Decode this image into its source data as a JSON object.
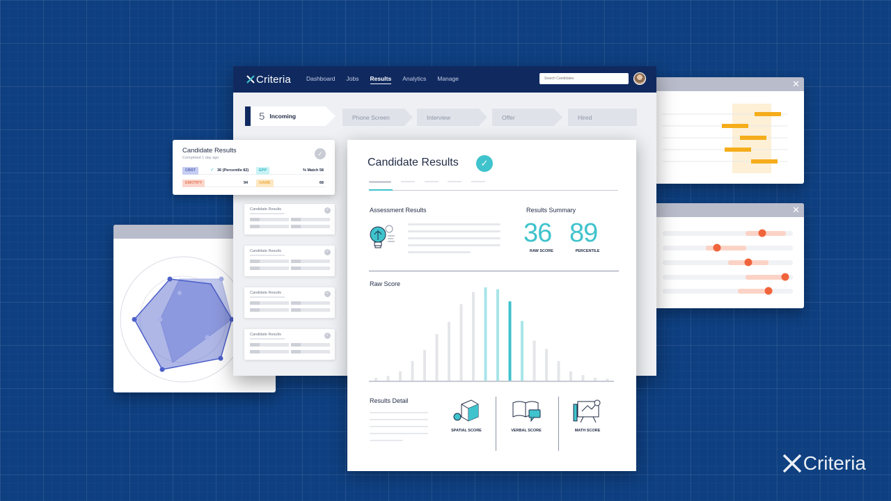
{
  "nav": {
    "brand": "Criteria",
    "links": [
      "Dashboard",
      "Jobs",
      "Results",
      "Analytics",
      "Manage"
    ],
    "active_link": "Results",
    "search_placeholder": "Search Candidates"
  },
  "pipeline": {
    "stages": [
      {
        "count": "5",
        "label": "Incoming"
      },
      {
        "label": "Phone Screen"
      },
      {
        "label": "Interview"
      },
      {
        "label": "Offer"
      },
      {
        "label": "Hired"
      }
    ]
  },
  "candidate_card": {
    "title": "Candidate Results",
    "subtitle": "Completed 1 day ago",
    "tests": [
      {
        "name": "CBST",
        "value": "36 (Percentile 82)",
        "color": "#c5cdf2",
        "text_color": "#5563b3"
      },
      {
        "name": "EPP",
        "value": "% Match 58",
        "color": "#c9f2f5",
        "text_color": "#34b9c4"
      },
      {
        "name": "EMOTIFY",
        "value": "94",
        "color": "#fbd6cc",
        "text_color": "#e8795b"
      },
      {
        "name": "GAME",
        "value": "68",
        "color": "#fde8c4",
        "text_color": "#f0a93c"
      }
    ]
  },
  "mini_cards": [
    {
      "title": "Candidate Results"
    },
    {
      "title": "Candidate Results"
    },
    {
      "title": "Candidate Results"
    },
    {
      "title": "Candidate Results"
    }
  ],
  "result": {
    "title": "Candidate Results",
    "assessment_title": "Assessment Results",
    "summary_title": "Results Summary",
    "raw_score": "36",
    "raw_score_label": "RAW SCORE",
    "percentile": "89",
    "percentile_label": "PERCENTILE",
    "raw_score_chart_title": "Raw Score",
    "detail_title": "Results Detail",
    "details": [
      "SPATIAL SCORE",
      "VERBAL SCORE",
      "MATH SCORE"
    ]
  },
  "chart_data": {
    "type": "bar",
    "title": "Raw Score",
    "values": [
      3,
      5,
      10,
      21,
      33,
      50,
      63,
      82,
      95,
      100,
      98,
      85,
      64,
      43,
      34,
      21,
      10,
      6,
      3,
      2
    ],
    "highlight_index": 11,
    "teal_indices": [
      10,
      12
    ],
    "colors": {
      "base": "#e4e6ea",
      "teal": "#a8e5e9",
      "highlight": "#3fc3cc"
    }
  },
  "colors": {
    "background": "#0e3f80",
    "nav": "#102a60",
    "accent": "#3fc3cc",
    "orange": "#f5ad1b",
    "coral": "#f0643c",
    "radar": "#4d60c9"
  }
}
